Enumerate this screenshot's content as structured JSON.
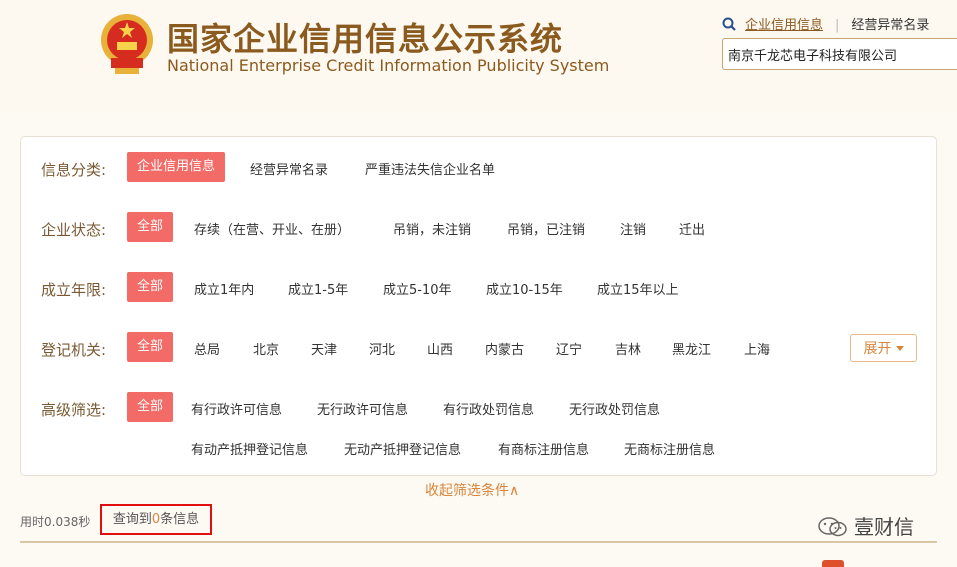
{
  "header": {
    "title_cn": "国家企业信用信息公示系统",
    "title_en": "National Enterprise Credit Information Publicity System",
    "links": [
      "企业信用信息",
      "经营异常名录"
    ],
    "search": {
      "value": "南京千龙芯电子科技有限公司"
    }
  },
  "filters": {
    "rows": [
      {
        "label": "信息分类:",
        "options": [
          "企业信用信息",
          "经营异常名录",
          "严重违法失信企业名单"
        ]
      },
      {
        "label": "企业状态:",
        "options": [
          "全部",
          "存续（在营、开业、在册）",
          "吊销，未注销",
          "吊销，已注销",
          "注销",
          "迁出"
        ]
      },
      {
        "label": "成立年限:",
        "options": [
          "全部",
          "成立1年内",
          "成立1-5年",
          "成立5-10年",
          "成立10-15年",
          "成立15年以上"
        ]
      },
      {
        "label": "登记机关:",
        "options": [
          "全部",
          "总局",
          "北京",
          "天津",
          "河北",
          "山西",
          "内蒙古",
          "辽宁",
          "吉林",
          "黑龙江",
          "上海"
        ]
      },
      {
        "label": "高级筛选:",
        "options": [
          "全部",
          "有行政许可信息",
          "无行政许可信息",
          "有行政处罚信息",
          "无行政处罚信息"
        ]
      }
    ],
    "advanced_row2": [
      "有动产抵押登记信息",
      "无动产抵押登记信息",
      "有商标注册信息",
      "无商标注册信息"
    ],
    "expand_label": "展开",
    "collapse_label": "收起筛选条件∧"
  },
  "results": {
    "time_text": "用时0.038秒",
    "prefix": "查询到",
    "count": "0",
    "suffix": "条信息"
  },
  "watermark": "壹财信",
  "colors": {
    "accent": "#f26b67",
    "brand": "#8b5a1e",
    "orange": "#d9853b",
    "highlight_border": "#e01010"
  }
}
